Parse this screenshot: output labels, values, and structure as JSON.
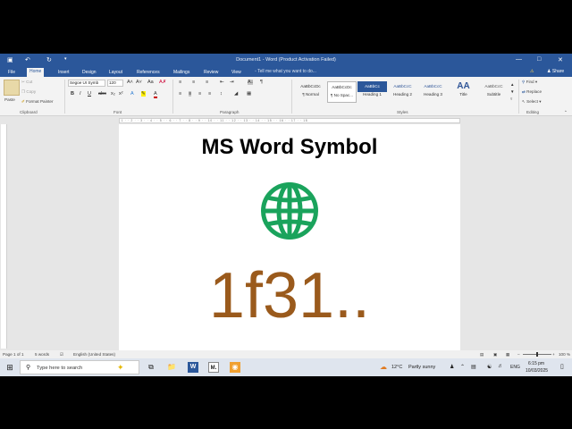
{
  "titlebar": {
    "title": "Document1 - Word (Product Activation Failed)",
    "save_icon": "save-icon",
    "undo_icon": "undo-icon",
    "redo_icon": "redo-icon",
    "window_controls": [
      "minimize",
      "maximize",
      "close"
    ]
  },
  "tabs": {
    "items": [
      "File",
      "Home",
      "Insert",
      "Design",
      "Layout",
      "References",
      "Mailings",
      "Review",
      "View"
    ],
    "active": "Home",
    "tell_me": "Tell me what you want to do...",
    "share": "Share"
  },
  "ribbon": {
    "clipboard": {
      "paste": "Paste",
      "cut": "Cut",
      "copy": "Copy",
      "format_painter": "Format Painter",
      "label": "Clipboard"
    },
    "font": {
      "family": "Segoe UI Symb",
      "size": "120",
      "label": "Font"
    },
    "paragraph": {
      "label": "Paragraph"
    },
    "styles": {
      "items": [
        {
          "preview": "AaBbCcDc",
          "name": "¶ Normal"
        },
        {
          "preview": "AaBbCcDc",
          "name": "¶ No Spac..."
        },
        {
          "preview": "AaBbCc",
          "name": "Heading 1"
        },
        {
          "preview": "AaBbCcC",
          "name": "Heading 2"
        },
        {
          "preview": "AaBbCcC",
          "name": "Heading 3"
        },
        {
          "preview": "AA",
          "name": "Title"
        },
        {
          "preview": "AaBbCcC",
          "name": "Subtitle"
        }
      ],
      "label": "Styles"
    },
    "editing": {
      "find": "Find",
      "replace": "Replace",
      "select": "Select",
      "label": "Editing"
    }
  },
  "document": {
    "heading": "MS Word Symbol",
    "symbol_icon": "globe-icon",
    "code_text": "1f31..",
    "colors": {
      "globe": "#1aa35c",
      "code": "#9a5a1c"
    }
  },
  "statusbar": {
    "page": "Page 1 of 1",
    "words": "5 words",
    "language": "English (United States)",
    "zoom": "100 %"
  },
  "taskbar": {
    "search_placeholder": "Type here to search",
    "weather_temp": "12°C",
    "weather_text": "Partly sunny",
    "lang": "ENG",
    "time": "6:15 pm",
    "date": "10/03/2025"
  }
}
